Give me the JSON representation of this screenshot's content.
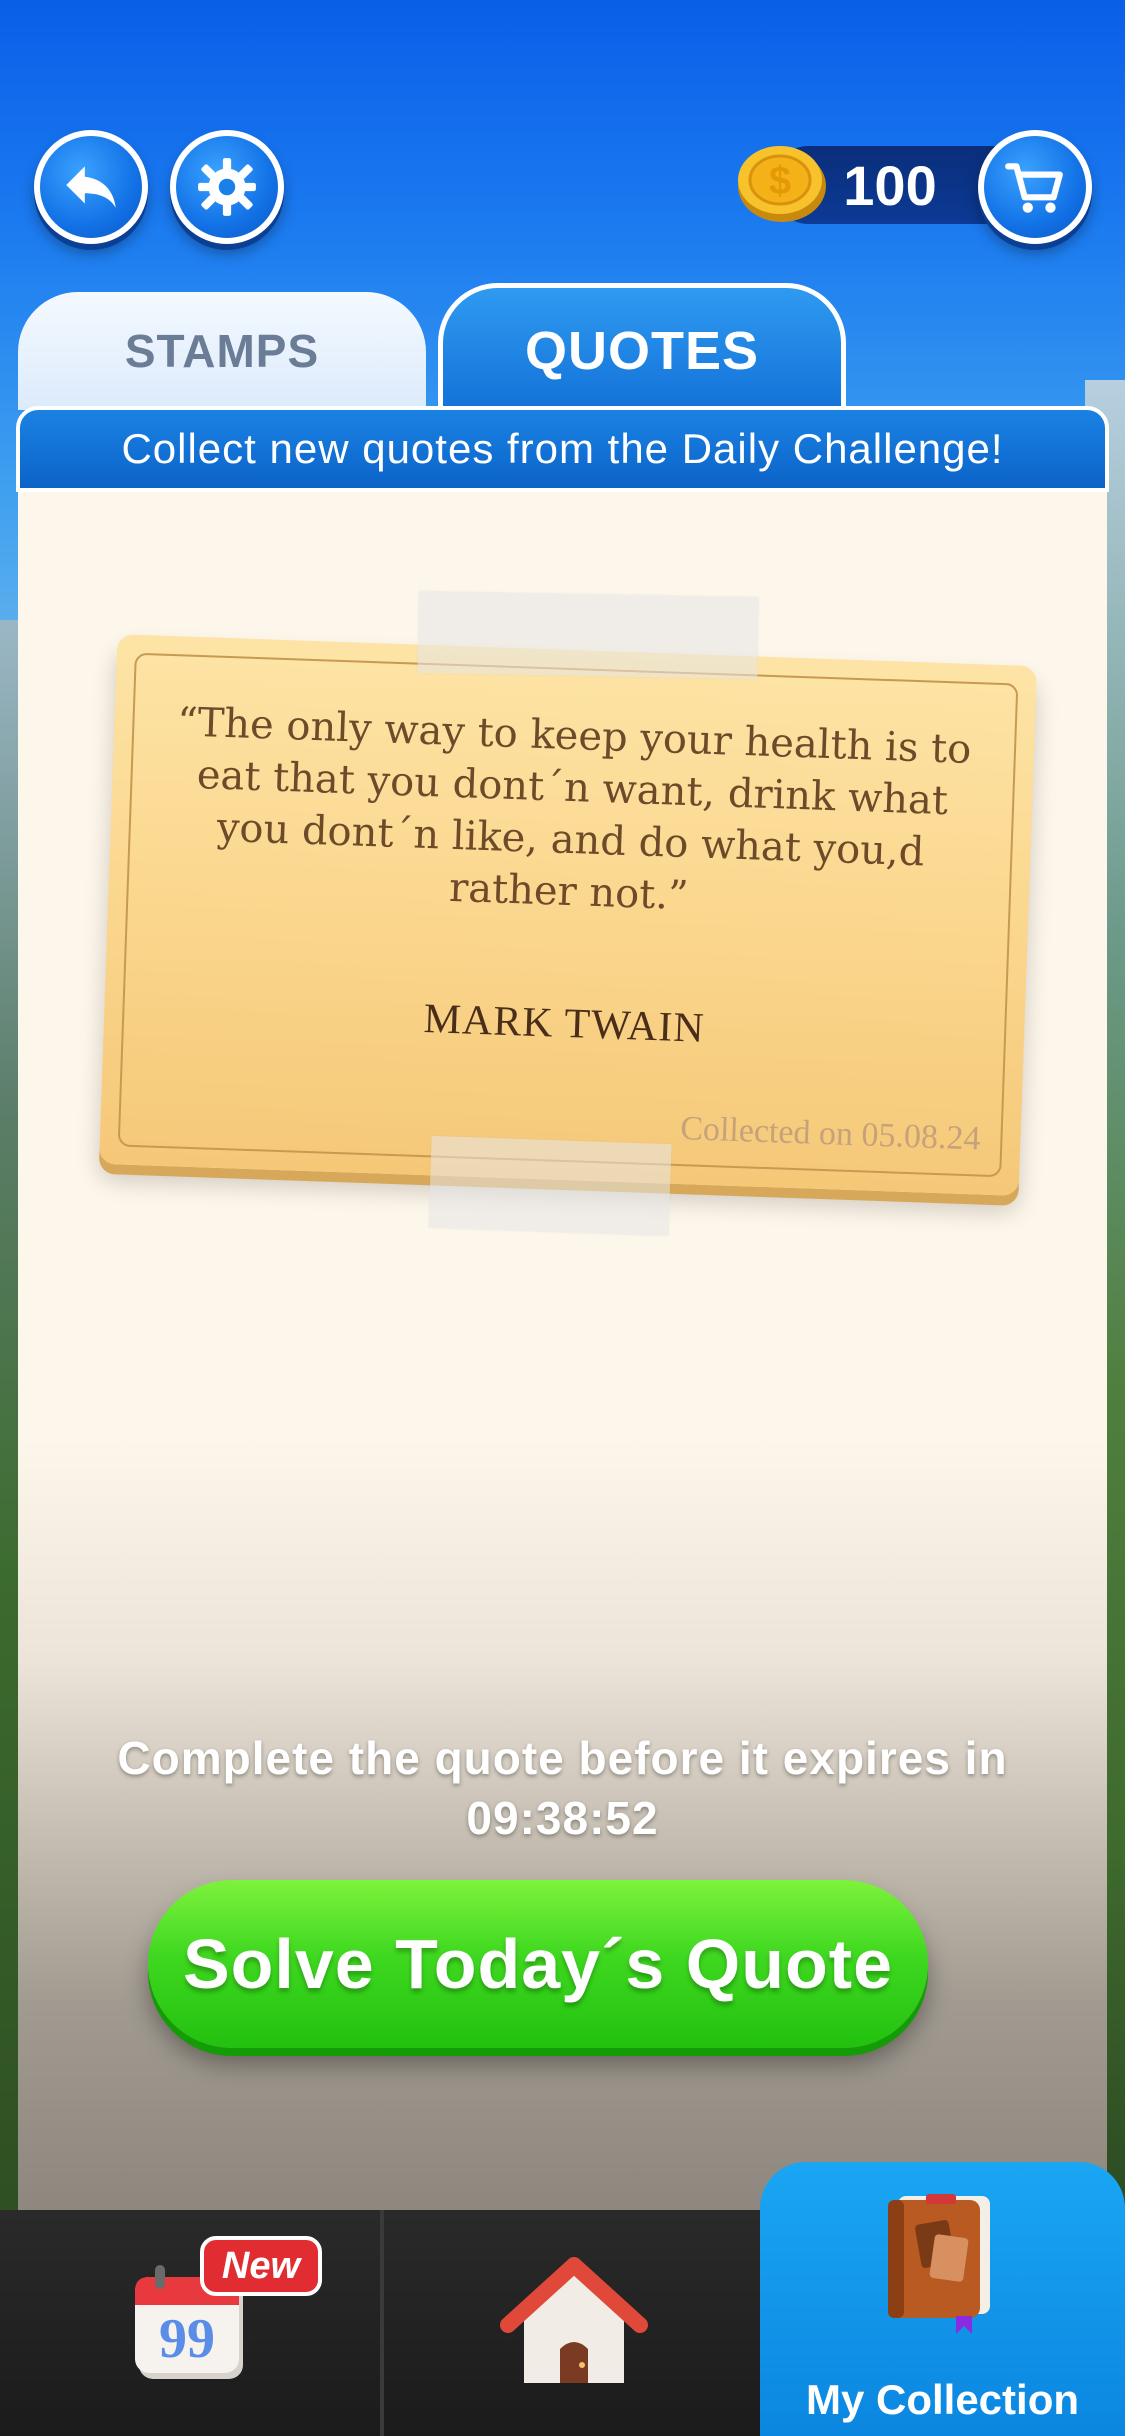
{
  "header": {
    "coins": "100",
    "icons": [
      "back-arrow-icon",
      "gear-icon",
      "coin-icon",
      "cart-icon"
    ]
  },
  "tabs": [
    {
      "label": "STAMPS",
      "active": false
    },
    {
      "label": "QUOTES",
      "active": true
    }
  ],
  "banner": {
    "text": "Collect new quotes from the Daily Challenge!"
  },
  "quote_card": {
    "quote": "“The only way to keep your health is to eat that you dont´n want, drink what you dont´n like, and do what you,d rather not.”",
    "author": "MARK TWAIN",
    "collected": "Collected on 05.08.24"
  },
  "timer": {
    "line1": "Complete the quote before it expires in",
    "countdown": "09:38:52"
  },
  "cta": {
    "label": "Solve Today´s Quote"
  },
  "bottom_nav": {
    "items": [
      {
        "name": "calendar",
        "badge": "New",
        "icon": "calendar-quote-icon"
      },
      {
        "name": "home",
        "icon": "house-icon"
      },
      {
        "name": "collection",
        "label": "My Collection",
        "icon": "book-icon",
        "active": true
      }
    ]
  },
  "colors": {
    "accent_blue": "#1271d8",
    "cta_green": "#3fd820",
    "badge_red": "#e12d31",
    "card_bg": "#fbd890"
  }
}
